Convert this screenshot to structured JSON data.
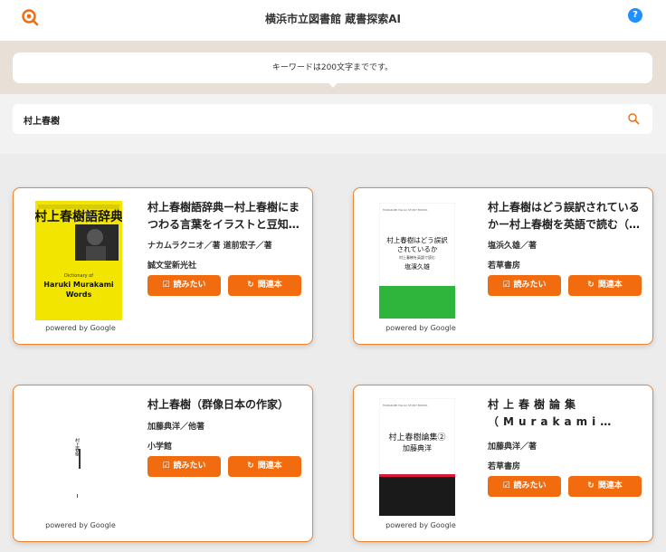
{
  "header": {
    "title": "横浜市立図書館 蔵書探索AI",
    "help_label": "?"
  },
  "notice": {
    "text": "キーワードは200文字までです。"
  },
  "search": {
    "value": "村上春樹"
  },
  "cover_brand": "powered by Google",
  "buttons": {
    "want_read": "読みたい",
    "related": "関連本"
  },
  "cards": [
    {
      "title": "村上春樹語辞典ー村上春樹にまつわる言葉をイラストと豆知識で読み解く",
      "author": "ナカムラクニオ／著 道前宏子／著",
      "publisher": "誠文堂新光社",
      "cover": {
        "main": "村上春樹語辞典",
        "sub": "Dictionary of",
        "en1": "Haruki Murakami",
        "en2": "Words"
      }
    },
    {
      "title": "村上春樹はどう誤訳されているかー村上春樹を英語で読む（平凡社新書）",
      "author": "塩浜久雄／著",
      "publisher": "若草書房",
      "cover": {
        "series": "MURAKAMI Haruki STUDY BOOKS",
        "main1": "村上春樹はどう誤訳",
        "main2": "されているか",
        "sub": "村上春樹を英語で読む",
        "author": "塩濱久雄"
      }
    },
    {
      "title": "村上春樹（群像日本の作家）",
      "author": "加藤典洋／他著",
      "publisher": "小学館",
      "cover": {
        "main": "村上春樹"
      }
    },
    {
      "title": "村上春樹論集（Murakami Haruki studies）",
      "author": "加藤典洋／著",
      "publisher": "若草書房",
      "cover": {
        "series": "MURAKAMI Haruki STUDY BOOKS",
        "main": "村上春樹論集②",
        "author": "加藤典洋"
      }
    }
  ]
}
